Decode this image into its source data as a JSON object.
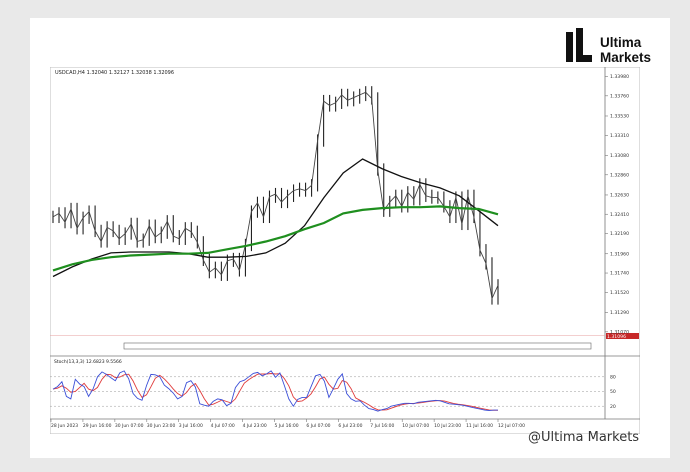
{
  "brand": {
    "line1": "Ultima",
    "line2": "Markets",
    "watermark": "@Ultima Markets"
  },
  "chart_data": {
    "type": "line",
    "symbol_header": "USDCAD,H4 1.32040 1.32127 1.32038 1.32096",
    "price_axis": [
      "1.33980",
      "1.33760",
      "1.33530",
      "1.33310",
      "1.33080",
      "1.32860",
      "1.32630",
      "1.32410",
      "1.32190",
      "1.31960",
      "1.31740",
      "1.31520",
      "1.31290",
      "1.31070"
    ],
    "current_price": "1.31096",
    "ylim": [
      1.3084,
      1.3402
    ],
    "time_labels": [
      "28 Jun 2023",
      "29 Jun 16:00",
      "30 Jun 07:00",
      "30 Jun 23:00",
      "3 Jul 16:00",
      "4 Jul 07:00",
      "4 Jul 23:00",
      "5 Jul 16:00",
      "6 Jul 07:00",
      "6 Jul 23:00",
      "7 Jul 16:00",
      "10 Jul 07:00",
      "10 Jul 23:00",
      "11 Jul 16:00",
      "12 Jul 07:00"
    ],
    "close": [
      1.3238,
      1.3242,
      1.3232,
      1.3247,
      1.3225,
      1.3237,
      1.3244,
      1.3222,
      1.321,
      1.3226,
      1.3222,
      1.3213,
      1.3219,
      1.323,
      1.321,
      1.3212,
      1.3228,
      1.3215,
      1.322,
      1.3233,
      1.3216,
      1.3213,
      1.3225,
      1.3221,
      1.3209,
      1.3189,
      1.3175,
      1.318,
      1.3172,
      1.3188,
      1.319,
      1.3177,
      1.3206,
      1.3244,
      1.3254,
      1.3238,
      1.3261,
      1.3264,
      1.3255,
      1.3262,
      1.3268,
      1.327,
      1.3268,
      1.3274,
      1.3325,
      1.337,
      1.3365,
      1.3368,
      1.3377,
      1.3371,
      1.3374,
      1.3377,
      1.338,
      1.3373,
      1.3292,
      1.3245,
      1.3255,
      1.3262,
      1.325,
      1.3266,
      1.3258,
      1.3275,
      1.3262,
      1.326,
      1.326,
      1.325,
      1.3238,
      1.326,
      1.323,
      1.3262,
      1.3238,
      1.32,
      1.3185,
      1.3145,
      1.316
    ],
    "series": [
      {
        "name": "MA 1",
        "color": "#111111",
        "values": [
          1.317,
          1.3181,
          1.319,
          1.3197,
          1.3198,
          1.3198,
          1.3198,
          1.3196,
          1.3192,
          1.3192,
          1.3193,
          1.3197,
          1.3208,
          1.3228,
          1.326,
          1.3288,
          1.3304,
          1.3293,
          1.3284,
          1.3277,
          1.3271,
          1.3262,
          1.3245,
          1.3228
        ]
      },
      {
        "name": "MA 2",
        "color": "#1f8f1f",
        "values": [
          1.3177,
          1.3184,
          1.3189,
          1.3192,
          1.3194,
          1.3195,
          1.3196,
          1.3196,
          1.3197,
          1.3201,
          1.3205,
          1.321,
          1.3216,
          1.3224,
          1.3231,
          1.3242,
          1.3246,
          1.3248,
          1.3249,
          1.3249,
          1.325,
          1.3248,
          1.3247,
          1.3241
        ]
      }
    ],
    "stoch": {
      "header": "Stoch(13,3,3) 12.6823 9.5566",
      "levels": [
        "80",
        "50",
        "20"
      ],
      "main": [
        55,
        60,
        70,
        40,
        35,
        75,
        65,
        60,
        40,
        55,
        80,
        90,
        85,
        78,
        72,
        88,
        92,
        76,
        46,
        36,
        32,
        62,
        85,
        84,
        80,
        63,
        56,
        47,
        35,
        40,
        68,
        72,
        59,
        25,
        22,
        20,
        30,
        35,
        33,
        21,
        26,
        58,
        70,
        73,
        80,
        87,
        89,
        82,
        86,
        92,
        79,
        88,
        62,
        35,
        20,
        34,
        38,
        38,
        60,
        82,
        85,
        71,
        38,
        56,
        75,
        86,
        46,
        35,
        30,
        31,
        22,
        15,
        13,
        10,
        13,
        15,
        20,
        22,
        24,
        26,
        26,
        25,
        28,
        29,
        30,
        31,
        32,
        31,
        28,
        25,
        24,
        23,
        22,
        20,
        18,
        16,
        14,
        12,
        11,
        12,
        12
      ]
    }
  }
}
